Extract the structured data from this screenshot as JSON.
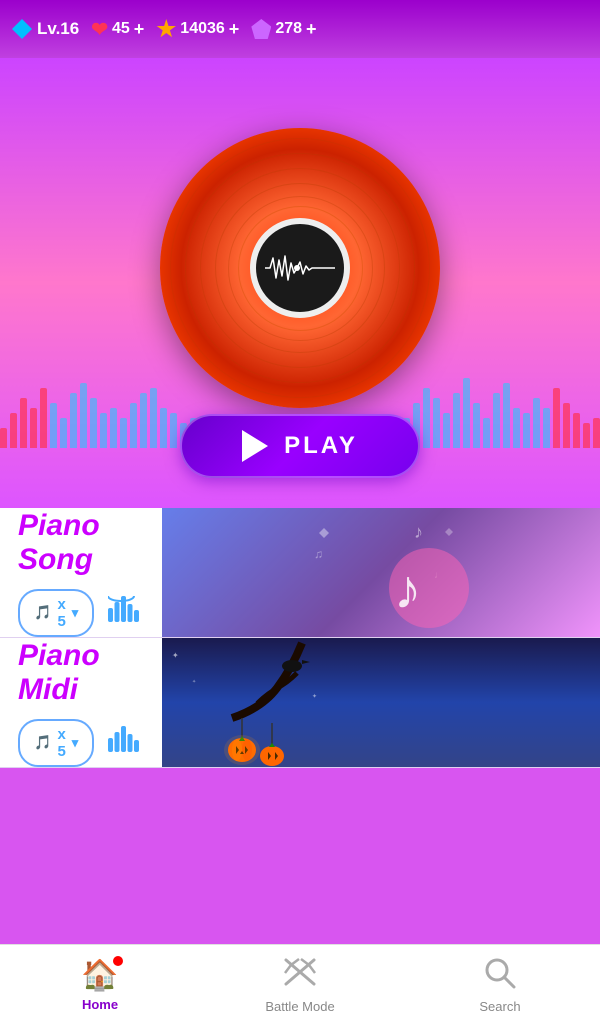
{
  "topbar": {
    "level_label": "Lv.16",
    "hearts": "45",
    "coins": "14036",
    "gems": "278",
    "plus": "+"
  },
  "play_button": {
    "label": "PLAY"
  },
  "cards": [
    {
      "title": "Piano Song",
      "ticket_count": "x 5",
      "type": "piano_song"
    },
    {
      "title": "Piano Midi",
      "ticket_count": "x 5",
      "type": "piano_midi"
    }
  ],
  "nav": {
    "home": "Home",
    "battle": "Battle Mode",
    "search": "Search"
  }
}
